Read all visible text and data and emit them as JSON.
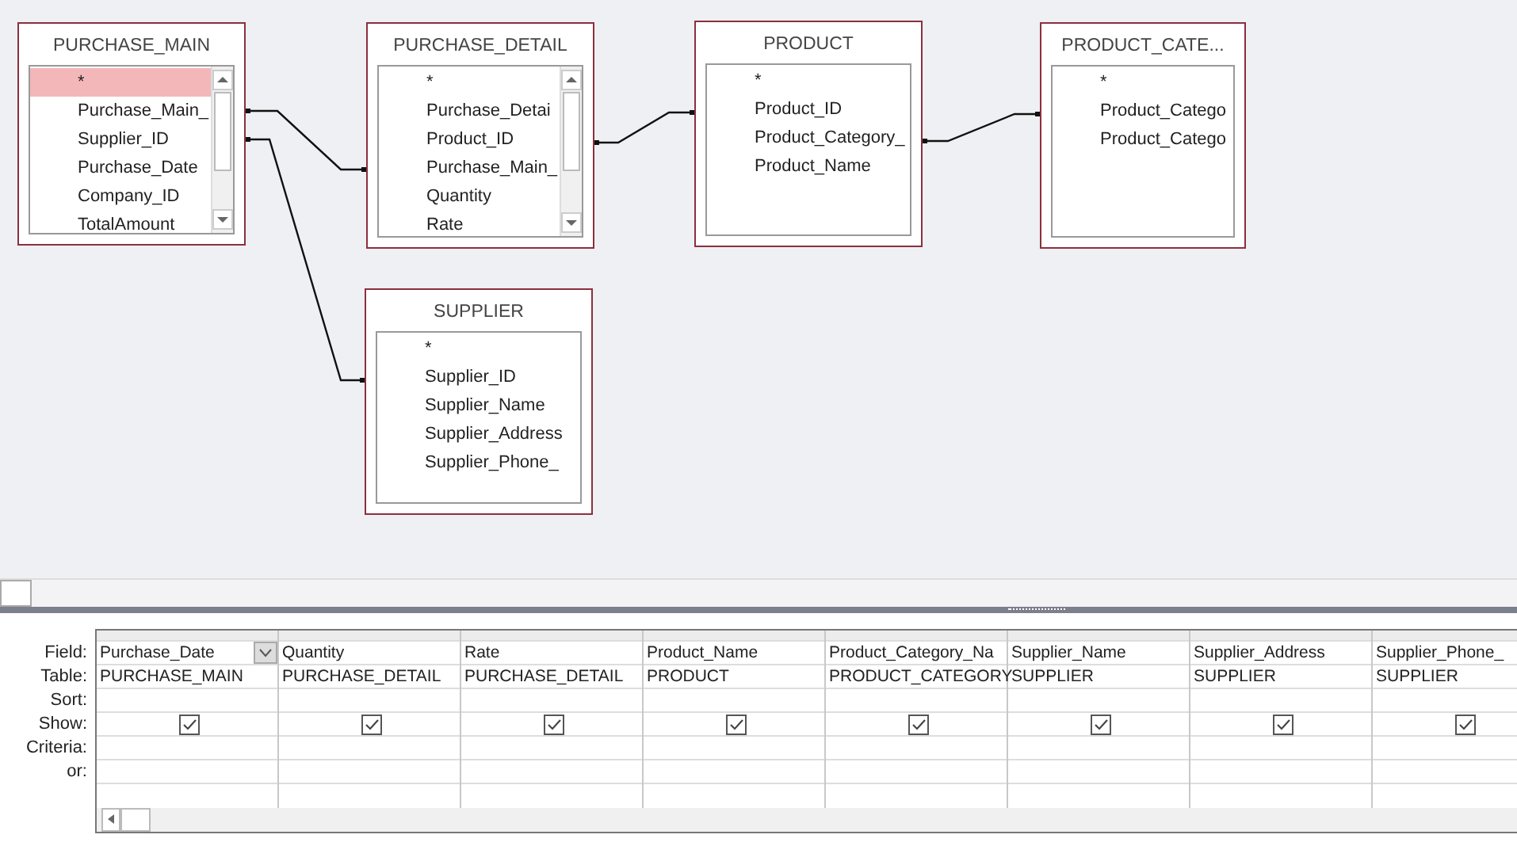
{
  "tables": [
    {
      "title": "PURCHASE_MAIN",
      "scrollbar": true,
      "fields": [
        {
          "name": "*",
          "selected": true
        },
        {
          "name": "Purchase_Main_",
          "selected": false
        },
        {
          "name": "Supplier_ID",
          "selected": false
        },
        {
          "name": "Purchase_Date",
          "selected": false
        },
        {
          "name": "Company_ID",
          "selected": false
        },
        {
          "name": "TotalAmount",
          "selected": false
        }
      ]
    },
    {
      "title": "PURCHASE_DETAIL",
      "scrollbar": true,
      "fields": [
        {
          "name": "*",
          "selected": false
        },
        {
          "name": "Purchase_Detai",
          "selected": false
        },
        {
          "name": "Product_ID",
          "selected": false
        },
        {
          "name": "Purchase_Main_",
          "selected": false
        },
        {
          "name": "Quantity",
          "selected": false
        },
        {
          "name": "Rate",
          "selected": false
        }
      ]
    },
    {
      "title": "PRODUCT",
      "scrollbar": false,
      "fields": [
        {
          "name": "*",
          "selected": false
        },
        {
          "name": "Product_ID",
          "selected": false
        },
        {
          "name": "Product_Category_",
          "selected": false
        },
        {
          "name": "Product_Name",
          "selected": false
        }
      ]
    },
    {
      "title": "PRODUCT_CATE...",
      "scrollbar": false,
      "fields": [
        {
          "name": "*",
          "selected": false
        },
        {
          "name": "Product_Catego",
          "selected": false
        },
        {
          "name": "Product_Catego",
          "selected": false
        }
      ]
    },
    {
      "title": "SUPPLIER",
      "scrollbar": false,
      "fields": [
        {
          "name": "*",
          "selected": false
        },
        {
          "name": "Supplier_ID",
          "selected": false
        },
        {
          "name": "Supplier_Name",
          "selected": false
        },
        {
          "name": "Supplier_Address",
          "selected": false
        },
        {
          "name": "Supplier_Phone_",
          "selected": false
        }
      ]
    }
  ],
  "grid": {
    "row_labels": [
      "Field:",
      "Table:",
      "Sort:",
      "Show:",
      "Criteria:",
      "or:"
    ],
    "columns": [
      {
        "field": "Purchase_Date",
        "table": "PURCHASE_MAIN",
        "show": true,
        "active": true
      },
      {
        "field": "Quantity",
        "table": "PURCHASE_DETAIL",
        "show": true,
        "active": false
      },
      {
        "field": "Rate",
        "table": "PURCHASE_DETAIL",
        "show": true,
        "active": false
      },
      {
        "field": "Product_Name",
        "table": "PRODUCT",
        "show": true,
        "active": false
      },
      {
        "field": "Product_Category_Na",
        "table": "PRODUCT_CATEGORY",
        "show": true,
        "active": false
      },
      {
        "field": "Supplier_Name",
        "table": "SUPPLIER",
        "show": true,
        "active": false
      },
      {
        "field": "Supplier_Address",
        "table": "SUPPLIER",
        "show": true,
        "active": false
      },
      {
        "field": "Supplier_Phone_",
        "table": "SUPPLIER",
        "show": true,
        "active": false
      }
    ]
  }
}
